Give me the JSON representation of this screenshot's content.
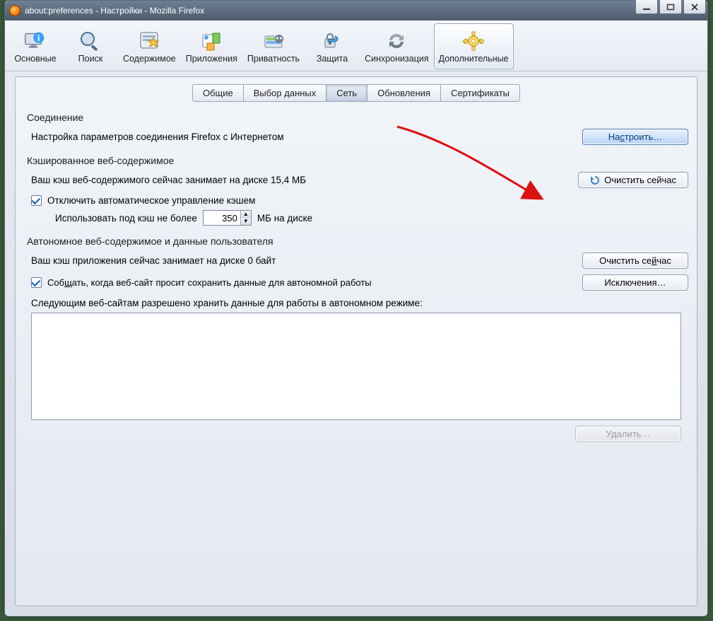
{
  "window": {
    "title": "about:preferences - Настройки - Mozilla Firefox"
  },
  "categories": [
    {
      "key": "general",
      "label": "Основные"
    },
    {
      "key": "search",
      "label": "Поиск"
    },
    {
      "key": "content",
      "label": "Содержимое"
    },
    {
      "key": "applications",
      "label": "Приложения"
    },
    {
      "key": "privacy",
      "label": "Приватность"
    },
    {
      "key": "security",
      "label": "Защита"
    },
    {
      "key": "sync",
      "label": "Синхронизация"
    },
    {
      "key": "advanced",
      "label": "Дополнительные"
    }
  ],
  "active_category": "advanced",
  "subtabs": [
    {
      "key": "general",
      "label": "Общие"
    },
    {
      "key": "data",
      "label": "Выбор данных"
    },
    {
      "key": "network",
      "label": "Сеть"
    },
    {
      "key": "updates",
      "label": "Обновления"
    },
    {
      "key": "certs",
      "label": "Сертификаты"
    }
  ],
  "active_subtab": "network",
  "connection": {
    "heading": "Соединение",
    "desc": "Настройка параметров соединения Firefox с Интернетом",
    "settings_btn": "Настроить…",
    "settings_accel": "с"
  },
  "cache": {
    "heading": "Кэшированное веб-содержимое",
    "status": "Ваш кэш веб-содержимого сейчас занимает на диске 15,4 МБ",
    "clear_btn": "Очистить сейчас",
    "override_label": "Отключить автоматическое управление кэшем",
    "override_checked": true,
    "limit_prefix": "Использовать под кэш не более",
    "limit_value": "350",
    "limit_suffix": "МБ на диске"
  },
  "offline": {
    "heading": "Автономное веб-содержимое и данные пользователя",
    "status": "Ваш кэш приложения сейчас занимает на диске 0 байт",
    "clear_btn": "Очистить сейчас",
    "clear_accel": "й",
    "notify_label": "Сообщать, когда веб-сайт просит сохранить данные для автономной работы",
    "notify_accel": "щ",
    "notify_checked": true,
    "exceptions_btn": "Исключения…",
    "list_label": "Следующим веб-сайтам разрешено хранить данные для работы в автономном режиме:",
    "remove_btn": "Удалить…"
  }
}
